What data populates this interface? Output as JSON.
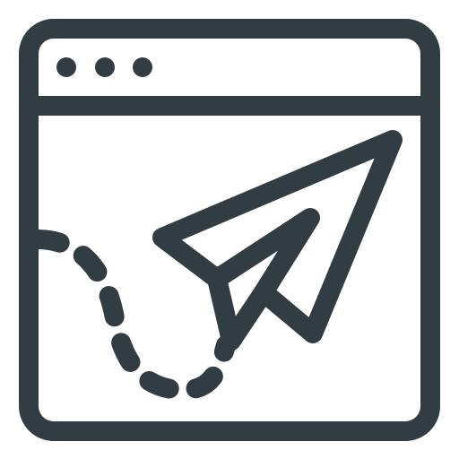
{
  "icon": {
    "name": "browser-window-paper-plane-icon",
    "stroke_color": "#323c43",
    "background_color": "#ffffff",
    "parts": {
      "window": "browser-window-icon",
      "title_bar_dots": "window-control-dots-icon",
      "plane": "paper-plane-icon",
      "trail": "dashed-flight-path-icon"
    }
  }
}
